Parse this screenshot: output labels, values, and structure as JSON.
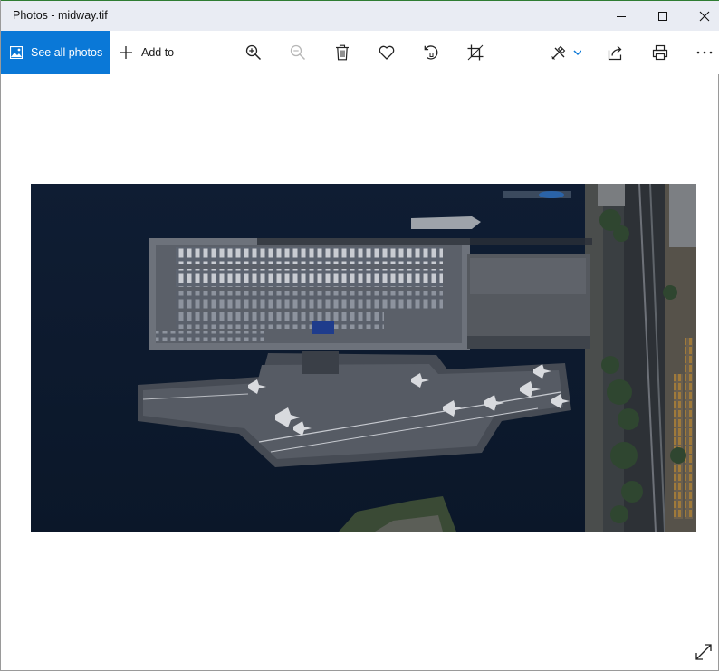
{
  "window": {
    "title": "Photos - midway.tif"
  },
  "caption_buttons": {
    "minimize": "minimize-icon",
    "maximize": "maximize-icon",
    "close": "close-icon"
  },
  "toolbar": {
    "see_all_label": "See all photos",
    "add_to_label": "Add to",
    "icons": [
      "zoom-in-icon",
      "zoom-out-icon",
      "delete-icon",
      "favorite-icon",
      "rotate-icon",
      "crop-icon",
      "edit-create-icon",
      "share-icon",
      "print-icon",
      "more-icon"
    ]
  },
  "image": {
    "subject": "Aerial satellite view of aircraft carrier docked at pier next to parking lot"
  },
  "colors": {
    "accent": "#0a78d7",
    "titlebar": "#e9ecf3",
    "water": "#0d1a2d"
  }
}
